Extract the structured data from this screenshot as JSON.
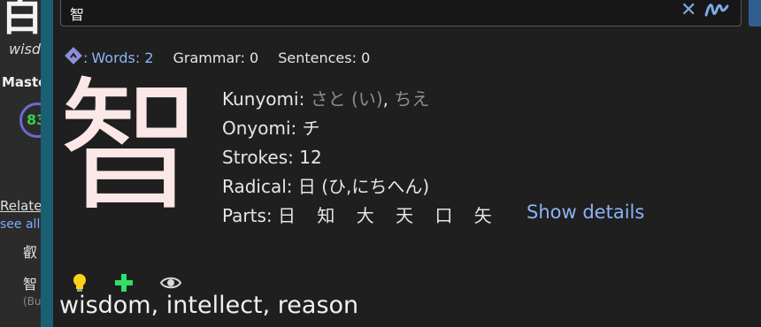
{
  "background": {
    "big_char": "白",
    "word": "wisd",
    "master_label": "Maste",
    "circle_value": "83",
    "related_label": "Relate",
    "see_all": "see all",
    "kanji_1": "叡",
    "kanji_2": "智",
    "bu": "(Bu"
  },
  "search": {
    "query": "智",
    "clear_icon": "✕"
  },
  "stats": {
    "words_label": "Words: 2",
    "grammar_label": "Grammar: 0",
    "sentences_label": "Sentences: 0"
  },
  "kanji": {
    "character": "智",
    "kunyomi_label": "Kunyomi:",
    "kunyomi_1": "さと (い)",
    "kunyomi_comma": ",",
    "kunyomi_2": "ちえ",
    "onyomi_label": "Onyomi:",
    "onyomi": "チ",
    "strokes_label": "Strokes:",
    "strokes": "12",
    "radical_label": "Radical:",
    "radical": "日 (ひ,にちへん)",
    "parts_label": "Parts:",
    "parts": [
      "日",
      "知",
      "大",
      "天",
      "口",
      "矢"
    ],
    "show_details": "Show details"
  },
  "meaning": "wisdom, intellect, reason",
  "colors": {
    "accent": "#8ab4f8",
    "kanji": "#fce7e7",
    "divider": "#1b5f72"
  }
}
